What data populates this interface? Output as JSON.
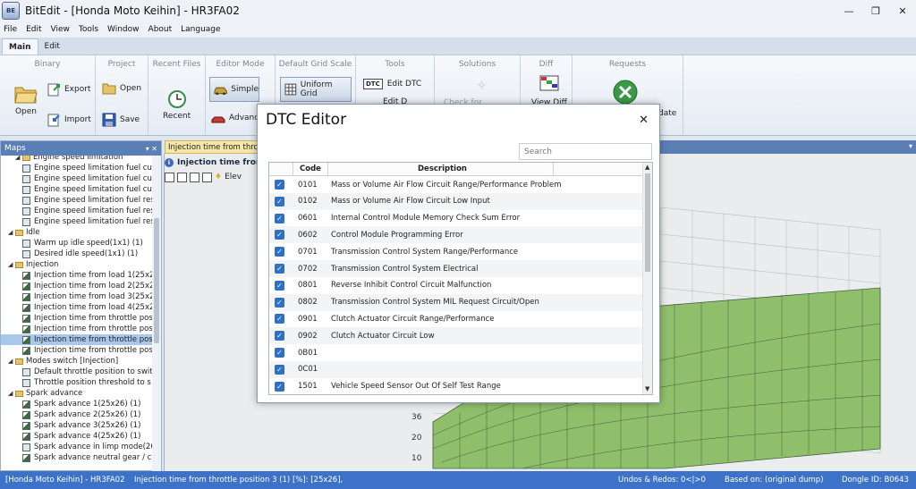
{
  "window": {
    "title": "BitEdit - [Honda Moto Keihin] - HR3FA02",
    "app_icon_text": "BE",
    "minimize": "—",
    "restore": "❐",
    "close": "✕"
  },
  "menu": [
    "File",
    "Edit",
    "View",
    "Tools",
    "Window",
    "About",
    "Language"
  ],
  "ribbon_tabs": [
    {
      "label": "Main",
      "active": true
    },
    {
      "label": "Edit",
      "active": false
    }
  ],
  "ribbon": {
    "binary": {
      "title": "Binary",
      "open": "Open",
      "export": "Export",
      "import": "Import"
    },
    "project": {
      "title": "Project",
      "open": "Open",
      "save": "Save"
    },
    "recent": {
      "title": "Recent Files",
      "recent": "Recent"
    },
    "editor_mode": {
      "title": "Editor Mode",
      "simple": "Simple",
      "advanced": "Advanc"
    },
    "grid_scale": {
      "title": "Default Grid Scale",
      "uniform": "Uniform Grid"
    },
    "tools": {
      "title": "Tools",
      "edit_dtc": "Edit DTC",
      "edit_d": "Edit D",
      "dtc_icon": "DTC"
    },
    "solutions": {
      "title": "Solutions",
      "check": "Check for Solutions"
    },
    "diff": {
      "title": "Diff",
      "view": "View Diff"
    },
    "requests": {
      "title": "Requests",
      "update": "date"
    }
  },
  "maps_panel": {
    "title": "Maps",
    "pin": "▾ ✕",
    "tree": [
      {
        "type": "folder",
        "label": "Engine speed limitation",
        "indent": 2,
        "open": true
      },
      {
        "type": "map",
        "label": "Engine speed limitation fuel cut",
        "indent": 3
      },
      {
        "type": "map",
        "label": "Engine speed limitation fuel cut",
        "indent": 3
      },
      {
        "type": "map",
        "label": "Engine speed limitation fuel cut",
        "indent": 3
      },
      {
        "type": "map",
        "label": "Engine speed limitation fuel res",
        "indent": 3
      },
      {
        "type": "map",
        "label": "Engine speed limitation fuel res",
        "indent": 3
      },
      {
        "type": "map",
        "label": "Engine speed limitation fuel res",
        "indent": 3
      },
      {
        "type": "folder",
        "label": "Idle",
        "indent": 1,
        "open": true
      },
      {
        "type": "map",
        "label": "Warm up idle speed(1x1) (1)",
        "indent": 3
      },
      {
        "type": "map",
        "label": "Desired idle speed(1x1) (1)",
        "indent": 3
      },
      {
        "type": "folder",
        "label": "Injection",
        "indent": 1,
        "open": true
      },
      {
        "type": "chart",
        "label": "Injection time from load 1(25x26",
        "indent": 3
      },
      {
        "type": "chart",
        "label": "Injection time from load 2(25x26",
        "indent": 3
      },
      {
        "type": "chart",
        "label": "Injection time from load 3(25x26",
        "indent": 3
      },
      {
        "type": "chart",
        "label": "Injection time from load 4(25x26",
        "indent": 3
      },
      {
        "type": "chart",
        "label": "Injection time from throttle pos",
        "indent": 3
      },
      {
        "type": "chart",
        "label": "Injection time from throttle pos",
        "indent": 3
      },
      {
        "type": "chart",
        "label": "Injection time from throttle pos",
        "indent": 3,
        "selected": true
      },
      {
        "type": "chart",
        "label": "Injection time from throttle pos",
        "indent": 3
      },
      {
        "type": "folder",
        "label": "Modes switch [Injection]",
        "indent": 1,
        "open": true
      },
      {
        "type": "map",
        "label": "Default throttle position to swit",
        "indent": 3
      },
      {
        "type": "map",
        "label": "Throttle position threshold to s",
        "indent": 3
      },
      {
        "type": "folder",
        "label": "Spark advance",
        "indent": 1,
        "open": true
      },
      {
        "type": "chart",
        "label": "Spark advance 1(25x26) (1)",
        "indent": 3
      },
      {
        "type": "chart",
        "label": "Spark advance 2(25x26) (1)",
        "indent": 3
      },
      {
        "type": "chart",
        "label": "Spark advance 3(25x26) (1)",
        "indent": 3
      },
      {
        "type": "chart",
        "label": "Spark advance 4(25x26) (1)",
        "indent": 3
      },
      {
        "type": "map",
        "label": "Spark advance in limp mode(26",
        "indent": 3
      },
      {
        "type": "chart",
        "label": "Spark advance neutral gear / ch",
        "indent": 3
      }
    ]
  },
  "document": {
    "tab_label": "Injection time from throttle",
    "header": "Injection time from",
    "info_icon": "i",
    "toolbar_text": "Elev",
    "axis_ticks": [
      "36",
      "20",
      "10"
    ]
  },
  "dtc_dialog": {
    "title": "DTC Editor",
    "close": "✕",
    "search_placeholder": "Search",
    "columns": {
      "code": "Code",
      "description": "Description"
    },
    "check_glyph": "✓",
    "rows": [
      {
        "code": "0101",
        "description": "Mass or Volume Air Flow Circuit Range/Performance Problem",
        "checked": true
      },
      {
        "code": "0102",
        "description": "Mass or Volume Air Flow Circuit Low Input",
        "checked": true
      },
      {
        "code": "0601",
        "description": "Internal Control Module Memory Check Sum Error",
        "checked": true
      },
      {
        "code": "0602",
        "description": "Control Module Programming Error",
        "checked": true
      },
      {
        "code": "0701",
        "description": "Transmission Control System Range/Performance",
        "checked": true
      },
      {
        "code": "0702",
        "description": "Transmission Control System Electrical",
        "checked": true
      },
      {
        "code": "0801",
        "description": "Reverse Inhibit Control Circuit Malfunction",
        "checked": true
      },
      {
        "code": "0802",
        "description": "Transmission Control System MIL Request Circuit/Open",
        "checked": true
      },
      {
        "code": "0901",
        "description": "Clutch Actuator Circuit Range/Performance",
        "checked": true
      },
      {
        "code": "0902",
        "description": "Clutch Actuator Circuit Low",
        "checked": true
      },
      {
        "code": "0B01",
        "description": "",
        "checked": true
      },
      {
        "code": "0C01",
        "description": "",
        "checked": true
      },
      {
        "code": "1501",
        "description": "Vehicle Speed Sensor Out Of Self Test Range",
        "checked": true
      }
    ]
  },
  "status_bar": {
    "project": "[Honda Moto Keihin] - HR3FA02",
    "map_info": "Injection time from throttle position 3 (1) [%]: [25x26],",
    "undo": "Undos & Redos: 0<|>0",
    "based_on": "Based on: (original dump)",
    "dongle": "Dongle ID: B0643"
  },
  "colors": {
    "accent": "#3c73c9",
    "panel_header": "#5a7fb5",
    "surface_green": "#8fbf6a",
    "check": "#2f6fc4"
  }
}
